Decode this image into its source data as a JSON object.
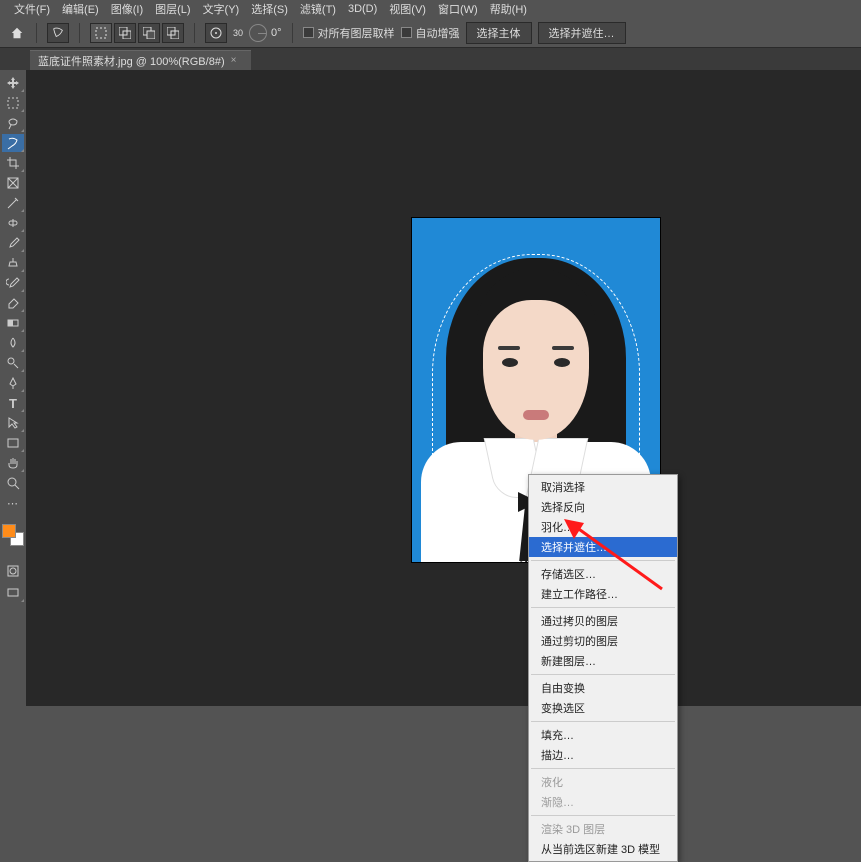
{
  "menu": {
    "file": "文件(F)",
    "edit": "编辑(E)",
    "image": "图像(I)",
    "layer": "图层(L)",
    "type": "文字(Y)",
    "select": "选择(S)",
    "filter": "滤镜(T)",
    "three_d": "3D(D)",
    "view": "视图(V)",
    "window": "窗口(W)",
    "help": "帮助(H)"
  },
  "options": {
    "angle_label": "30",
    "angle_value": "0°",
    "sample_all": "对所有图层取样",
    "auto_enhance": "自动增强",
    "select_subject": "选择主体",
    "select_and_mask": "选择并遮住…"
  },
  "tab": {
    "title": "蓝底证件照素材.jpg @ 100%(RGB/8#)",
    "close": "×"
  },
  "context": {
    "items": [
      {
        "label": "取消选择",
        "enabled": true
      },
      {
        "label": "选择反向",
        "enabled": true
      },
      {
        "label": "羽化…",
        "enabled": true
      },
      {
        "label": "选择并遮住…",
        "enabled": true,
        "highlight": true
      },
      {
        "sep": true
      },
      {
        "label": "存储选区…",
        "enabled": true
      },
      {
        "label": "建立工作路径…",
        "enabled": true
      },
      {
        "sep": true
      },
      {
        "label": "通过拷贝的图层",
        "enabled": true
      },
      {
        "label": "通过剪切的图层",
        "enabled": true
      },
      {
        "label": "新建图层…",
        "enabled": true
      },
      {
        "sep": true
      },
      {
        "label": "自由变换",
        "enabled": true
      },
      {
        "label": "变换选区",
        "enabled": true
      },
      {
        "sep": true
      },
      {
        "label": "填充…",
        "enabled": true
      },
      {
        "label": "描边…",
        "enabled": true
      },
      {
        "sep": true
      },
      {
        "label": "液化",
        "enabled": false
      },
      {
        "label": "渐隐…",
        "enabled": false
      },
      {
        "sep": true
      },
      {
        "label": "渲染 3D 图层",
        "enabled": false
      },
      {
        "label": "从当前选区新建 3D 模型",
        "enabled": true
      }
    ]
  },
  "colors": {
    "foreground": "#ff8c1a",
    "background": "#ffffff",
    "canvas_bg": "#2089d6"
  }
}
